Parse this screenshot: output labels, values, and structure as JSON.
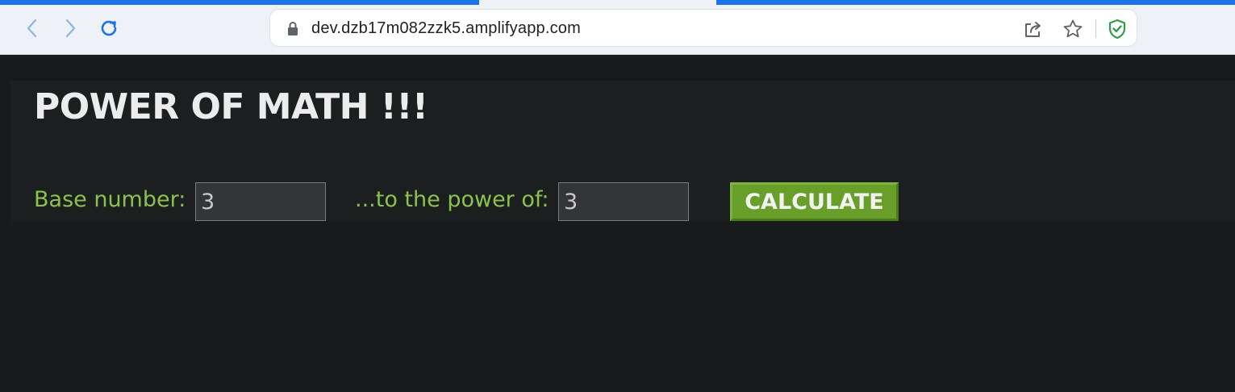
{
  "browser": {
    "url": "dev.dzb17m082zzk5.amplifyapp.com",
    "accent_color": "#1a73e8",
    "icons": [
      "back-icon",
      "forward-icon",
      "reload-icon",
      "lock-icon",
      "share-icon",
      "star-icon",
      "shield-check-icon"
    ]
  },
  "app": {
    "title": "POWER OF MATH !!!",
    "base_label": "Base number:",
    "base_value": "3",
    "power_label": "...to the power of:",
    "power_value": "3",
    "calculate_label": "CALCULATE",
    "label_color": "#8bc34a",
    "button_color": "#689f29"
  }
}
